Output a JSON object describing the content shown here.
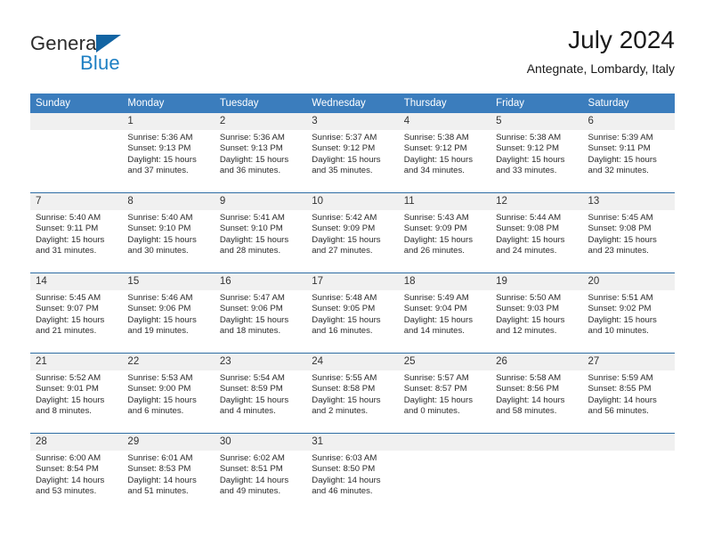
{
  "brand": {
    "name_part1": "General",
    "name_part2": "Blue",
    "logo_icon": "triangle-icon"
  },
  "header": {
    "month_title": "July 2024",
    "location": "Antegnate, Lombardy, Italy"
  },
  "calendar": {
    "weekday_headers": [
      "Sunday",
      "Monday",
      "Tuesday",
      "Wednesday",
      "Thursday",
      "Friday",
      "Saturday"
    ],
    "accent_color": "#3b7dbd",
    "row_border_color": "#2e6da4",
    "daynum_background": "#f0f0f0",
    "labels": {
      "sunrise": "Sunrise:",
      "sunset": "Sunset:",
      "daylight": "Daylight:"
    },
    "weeks": [
      [
        {
          "empty": true
        },
        {
          "day": "1",
          "sunrise": "Sunrise: 5:36 AM",
          "sunset": "Sunset: 9:13 PM",
          "daylight_line1": "Daylight: 15 hours",
          "daylight_line2": "and 37 minutes."
        },
        {
          "day": "2",
          "sunrise": "Sunrise: 5:36 AM",
          "sunset": "Sunset: 9:13 PM",
          "daylight_line1": "Daylight: 15 hours",
          "daylight_line2": "and 36 minutes."
        },
        {
          "day": "3",
          "sunrise": "Sunrise: 5:37 AM",
          "sunset": "Sunset: 9:12 PM",
          "daylight_line1": "Daylight: 15 hours",
          "daylight_line2": "and 35 minutes."
        },
        {
          "day": "4",
          "sunrise": "Sunrise: 5:38 AM",
          "sunset": "Sunset: 9:12 PM",
          "daylight_line1": "Daylight: 15 hours",
          "daylight_line2": "and 34 minutes."
        },
        {
          "day": "5",
          "sunrise": "Sunrise: 5:38 AM",
          "sunset": "Sunset: 9:12 PM",
          "daylight_line1": "Daylight: 15 hours",
          "daylight_line2": "and 33 minutes."
        },
        {
          "day": "6",
          "sunrise": "Sunrise: 5:39 AM",
          "sunset": "Sunset: 9:11 PM",
          "daylight_line1": "Daylight: 15 hours",
          "daylight_line2": "and 32 minutes."
        }
      ],
      [
        {
          "day": "7",
          "sunrise": "Sunrise: 5:40 AM",
          "sunset": "Sunset: 9:11 PM",
          "daylight_line1": "Daylight: 15 hours",
          "daylight_line2": "and 31 minutes."
        },
        {
          "day": "8",
          "sunrise": "Sunrise: 5:40 AM",
          "sunset": "Sunset: 9:10 PM",
          "daylight_line1": "Daylight: 15 hours",
          "daylight_line2": "and 30 minutes."
        },
        {
          "day": "9",
          "sunrise": "Sunrise: 5:41 AM",
          "sunset": "Sunset: 9:10 PM",
          "daylight_line1": "Daylight: 15 hours",
          "daylight_line2": "and 28 minutes."
        },
        {
          "day": "10",
          "sunrise": "Sunrise: 5:42 AM",
          "sunset": "Sunset: 9:09 PM",
          "daylight_line1": "Daylight: 15 hours",
          "daylight_line2": "and 27 minutes."
        },
        {
          "day": "11",
          "sunrise": "Sunrise: 5:43 AM",
          "sunset": "Sunset: 9:09 PM",
          "daylight_line1": "Daylight: 15 hours",
          "daylight_line2": "and 26 minutes."
        },
        {
          "day": "12",
          "sunrise": "Sunrise: 5:44 AM",
          "sunset": "Sunset: 9:08 PM",
          "daylight_line1": "Daylight: 15 hours",
          "daylight_line2": "and 24 minutes."
        },
        {
          "day": "13",
          "sunrise": "Sunrise: 5:45 AM",
          "sunset": "Sunset: 9:08 PM",
          "daylight_line1": "Daylight: 15 hours",
          "daylight_line2": "and 23 minutes."
        }
      ],
      [
        {
          "day": "14",
          "sunrise": "Sunrise: 5:45 AM",
          "sunset": "Sunset: 9:07 PM",
          "daylight_line1": "Daylight: 15 hours",
          "daylight_line2": "and 21 minutes."
        },
        {
          "day": "15",
          "sunrise": "Sunrise: 5:46 AM",
          "sunset": "Sunset: 9:06 PM",
          "daylight_line1": "Daylight: 15 hours",
          "daylight_line2": "and 19 minutes."
        },
        {
          "day": "16",
          "sunrise": "Sunrise: 5:47 AM",
          "sunset": "Sunset: 9:06 PM",
          "daylight_line1": "Daylight: 15 hours",
          "daylight_line2": "and 18 minutes."
        },
        {
          "day": "17",
          "sunrise": "Sunrise: 5:48 AM",
          "sunset": "Sunset: 9:05 PM",
          "daylight_line1": "Daylight: 15 hours",
          "daylight_line2": "and 16 minutes."
        },
        {
          "day": "18",
          "sunrise": "Sunrise: 5:49 AM",
          "sunset": "Sunset: 9:04 PM",
          "daylight_line1": "Daylight: 15 hours",
          "daylight_line2": "and 14 minutes."
        },
        {
          "day": "19",
          "sunrise": "Sunrise: 5:50 AM",
          "sunset": "Sunset: 9:03 PM",
          "daylight_line1": "Daylight: 15 hours",
          "daylight_line2": "and 12 minutes."
        },
        {
          "day": "20",
          "sunrise": "Sunrise: 5:51 AM",
          "sunset": "Sunset: 9:02 PM",
          "daylight_line1": "Daylight: 15 hours",
          "daylight_line2": "and 10 minutes."
        }
      ],
      [
        {
          "day": "21",
          "sunrise": "Sunrise: 5:52 AM",
          "sunset": "Sunset: 9:01 PM",
          "daylight_line1": "Daylight: 15 hours",
          "daylight_line2": "and 8 minutes."
        },
        {
          "day": "22",
          "sunrise": "Sunrise: 5:53 AM",
          "sunset": "Sunset: 9:00 PM",
          "daylight_line1": "Daylight: 15 hours",
          "daylight_line2": "and 6 minutes."
        },
        {
          "day": "23",
          "sunrise": "Sunrise: 5:54 AM",
          "sunset": "Sunset: 8:59 PM",
          "daylight_line1": "Daylight: 15 hours",
          "daylight_line2": "and 4 minutes."
        },
        {
          "day": "24",
          "sunrise": "Sunrise: 5:55 AM",
          "sunset": "Sunset: 8:58 PM",
          "daylight_line1": "Daylight: 15 hours",
          "daylight_line2": "and 2 minutes."
        },
        {
          "day": "25",
          "sunrise": "Sunrise: 5:57 AM",
          "sunset": "Sunset: 8:57 PM",
          "daylight_line1": "Daylight: 15 hours",
          "daylight_line2": "and 0 minutes."
        },
        {
          "day": "26",
          "sunrise": "Sunrise: 5:58 AM",
          "sunset": "Sunset: 8:56 PM",
          "daylight_line1": "Daylight: 14 hours",
          "daylight_line2": "and 58 minutes."
        },
        {
          "day": "27",
          "sunrise": "Sunrise: 5:59 AM",
          "sunset": "Sunset: 8:55 PM",
          "daylight_line1": "Daylight: 14 hours",
          "daylight_line2": "and 56 minutes."
        }
      ],
      [
        {
          "day": "28",
          "sunrise": "Sunrise: 6:00 AM",
          "sunset": "Sunset: 8:54 PM",
          "daylight_line1": "Daylight: 14 hours",
          "daylight_line2": "and 53 minutes."
        },
        {
          "day": "29",
          "sunrise": "Sunrise: 6:01 AM",
          "sunset": "Sunset: 8:53 PM",
          "daylight_line1": "Daylight: 14 hours",
          "daylight_line2": "and 51 minutes."
        },
        {
          "day": "30",
          "sunrise": "Sunrise: 6:02 AM",
          "sunset": "Sunset: 8:51 PM",
          "daylight_line1": "Daylight: 14 hours",
          "daylight_line2": "and 49 minutes."
        },
        {
          "day": "31",
          "sunrise": "Sunrise: 6:03 AM",
          "sunset": "Sunset: 8:50 PM",
          "daylight_line1": "Daylight: 14 hours",
          "daylight_line2": "and 46 minutes."
        },
        {
          "empty": true
        },
        {
          "empty": true
        },
        {
          "empty": true
        }
      ]
    ]
  }
}
